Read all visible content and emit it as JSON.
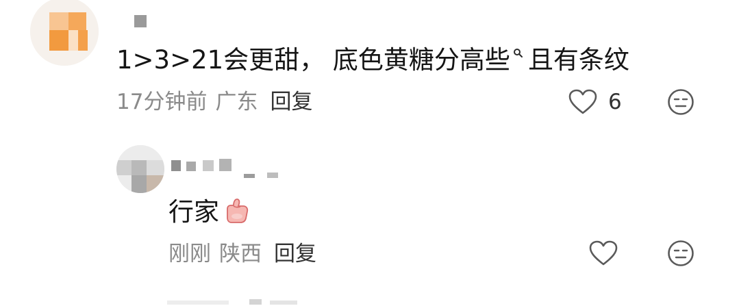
{
  "comment_1": {
    "text_before": "1>3>21会更甜， 底色黄糖分高些",
    "text_after": "且有条纹",
    "time": "17分钟前",
    "location": "广东",
    "reply_label": "回复",
    "likes": "6"
  },
  "comment_2": {
    "text": "行家",
    "time": "刚刚",
    "location": "陕西",
    "reply_label": "回复"
  },
  "colors": {
    "text": "#151515",
    "meta": "#8a8a8a",
    "icon": "#5a5a5a",
    "avatar_orange": "#f29a3f"
  },
  "icons": {
    "search_hint": "search-icon",
    "like": "heart-icon",
    "dislike": "meh-face-icon",
    "emoji": "thumbs-up-emoji-icon"
  }
}
